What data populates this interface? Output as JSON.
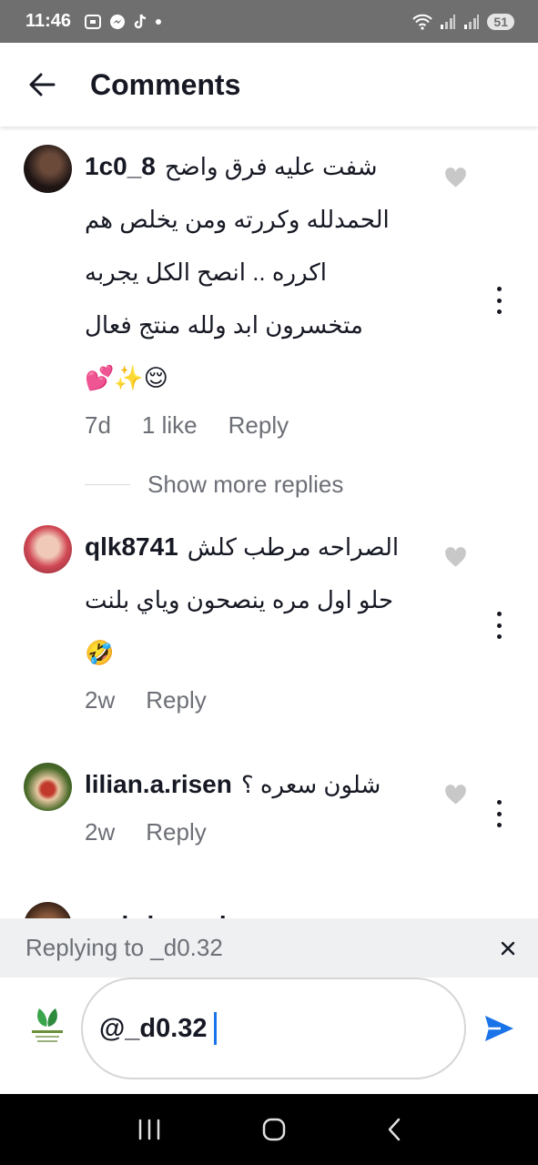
{
  "status_bar": {
    "time": "11:46",
    "battery": "51"
  },
  "header": {
    "title": "Comments"
  },
  "comments": [
    {
      "username": "1c0_8",
      "lines": [
        "شفت عليه فرق واضح",
        "الحمدلله  وكررته ومن يخلص هم",
        "اكرره .. انصح الكل يجربه",
        "متخسرون ابد ولله منتج فعال",
        "💕✨😌"
      ],
      "time": "7d",
      "likes": "1 like",
      "reply": "Reply"
    },
    {
      "username": "qlk8741",
      "lines": [
        "الصراحه مرطب كلش",
        "حلو اول مره ينصحون وياي بلنت",
        "🤣"
      ],
      "time": "2w",
      "reply": "Reply"
    },
    {
      "username": "lilian.a.risen",
      "lines": [
        "شلون سعره ؟"
      ],
      "time": "2w",
      "reply": "Reply"
    },
    {
      "username": "mehri_meeh_mm"
    }
  ],
  "show_more_replies": "Show more replies",
  "reply_banner": {
    "text": "Replying to _d0.32"
  },
  "input": {
    "value": "@_d0.32"
  },
  "colors": {
    "accent": "#1a73e8",
    "send": "#1a73e8",
    "muted": "#6c6f76"
  }
}
